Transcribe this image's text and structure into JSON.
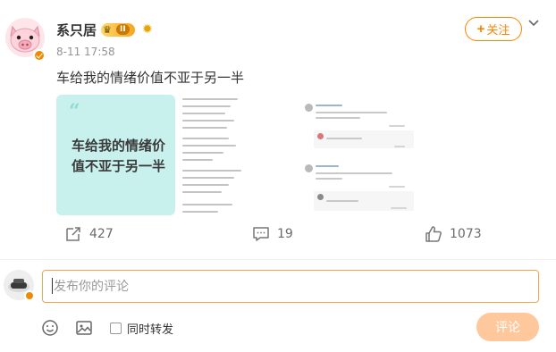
{
  "author": {
    "name": "系只居",
    "vip_level": "II",
    "vip_crown": "♛",
    "sun_badge": "✹",
    "timestamp": "8-11 17:58"
  },
  "follow_button": {
    "plus": "+",
    "label": "关注"
  },
  "post": {
    "text": "车给我的情绪价值不亚于另一半",
    "image_card_quote": "“",
    "image_card_text": "车给我的情绪价值不亚于另一半"
  },
  "actions": {
    "repost_count": "427",
    "comment_count": "19",
    "like_count": "1073"
  },
  "composer": {
    "placeholder": "发布你的评论",
    "repost_label": "同时转发",
    "repost_checked": false,
    "submit_label": "评论"
  },
  "colors": {
    "accent": "#ff8200",
    "teal_card": "#c8f1ee",
    "submit_disabled": "#ffc79c"
  },
  "icons": {
    "repost": "repost-icon",
    "comment": "comment-icon",
    "like": "like-icon",
    "emoji": "emoji-icon",
    "image": "image-icon",
    "menu": "chevron-down-icon"
  }
}
